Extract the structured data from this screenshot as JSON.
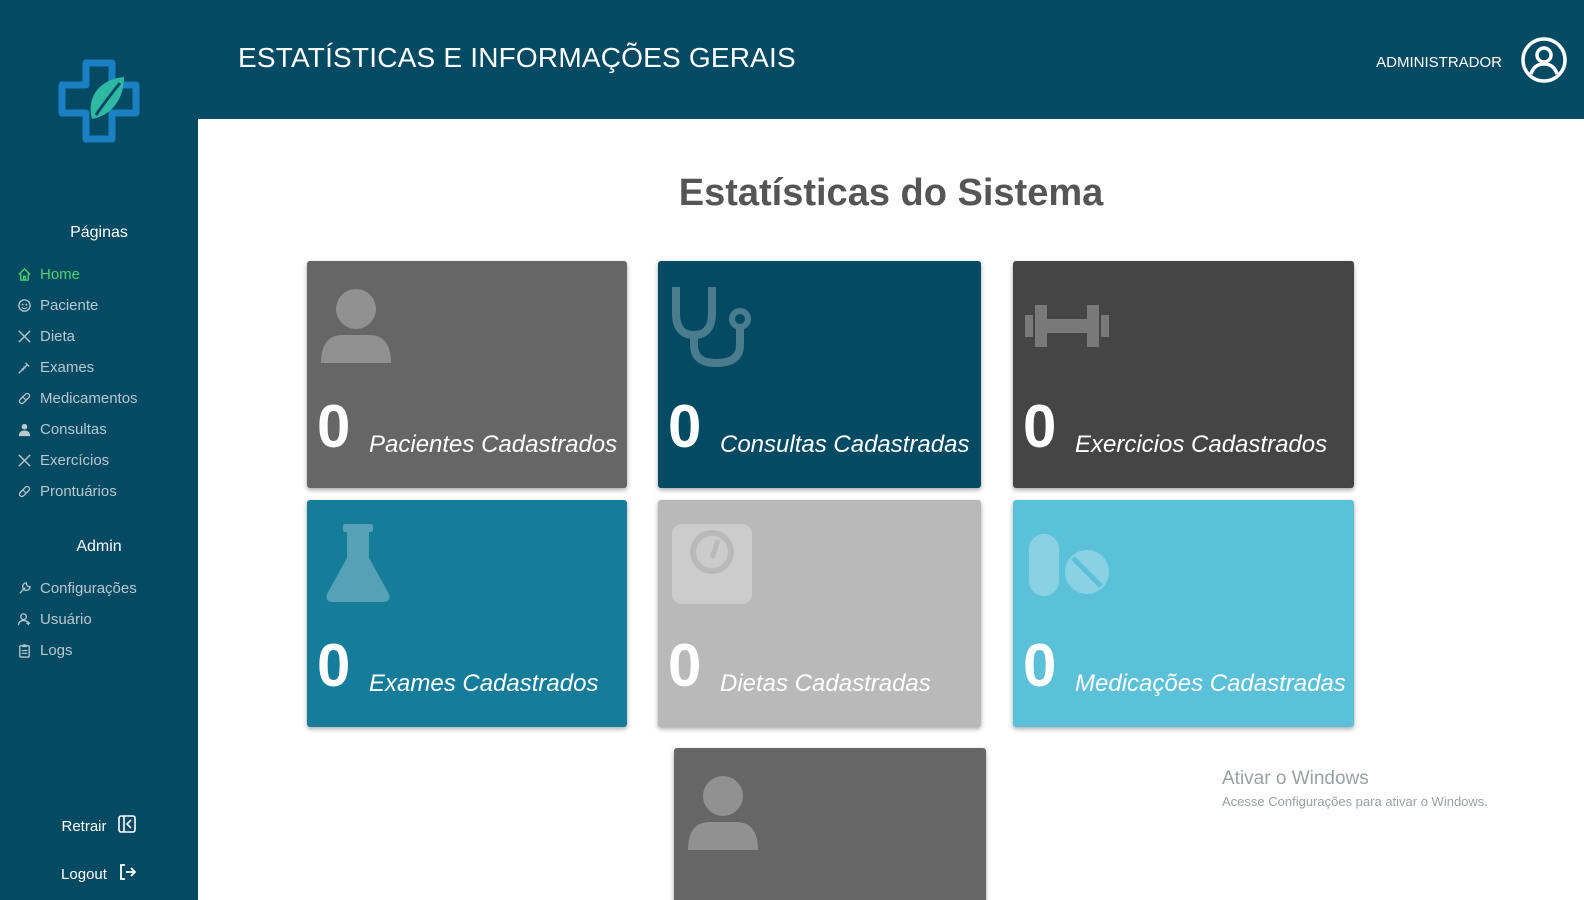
{
  "sidebar": {
    "pages_title": "Páginas",
    "pages": [
      {
        "label": "Home",
        "icon": "home-icon"
      },
      {
        "label": "Paciente",
        "icon": "patient-icon"
      },
      {
        "label": "Dieta",
        "icon": "cutlery-icon"
      },
      {
        "label": "Exames",
        "icon": "syringe-icon"
      },
      {
        "label": "Medicamentos",
        "icon": "pill-icon"
      },
      {
        "label": "Consultas",
        "icon": "doctor-icon"
      },
      {
        "label": "Exercícios",
        "icon": "cutlery-icon"
      },
      {
        "label": "Prontuários",
        "icon": "pill-icon"
      }
    ],
    "admin_title": "Admin",
    "admin": [
      {
        "label": "Configurações",
        "icon": "wrench-icon"
      },
      {
        "label": "Usuário",
        "icon": "user-icon"
      },
      {
        "label": "Logs",
        "icon": "clipboard-icon"
      }
    ],
    "retract_label": "Retrair",
    "logout_label": "Logout"
  },
  "header": {
    "title": "ESTATÍSTICAS E INFORMAÇÕES GERAIS",
    "user_label": "ADMINISTRADOR"
  },
  "main": {
    "heading": "Estatísticas do Sistema",
    "cards": [
      {
        "count": "0",
        "label": "Pacientes Cadastrados",
        "icon": "user-icon",
        "color": "#666666"
      },
      {
        "count": "0",
        "label": "Consultas Cadastradas",
        "icon": "stethoscope-icon",
        "color": "#044a63"
      },
      {
        "count": "0",
        "label": "Exercicios Cadastrados",
        "icon": "dumbbell-icon",
        "color": "#454545"
      },
      {
        "count": "0",
        "label": "Exames Cadastrados",
        "icon": "flask-icon",
        "color": "#157d99"
      },
      {
        "count": "0",
        "label": "Dietas Cadastradas",
        "icon": "scale-icon",
        "color": "#b9b9b9"
      },
      {
        "count": "0",
        "label": "Medicações Cadastradas",
        "icon": "pills-icon",
        "color": "#5bc1d9"
      },
      {
        "count": "",
        "label": "",
        "icon": "user-icon",
        "color": "#666666"
      }
    ]
  },
  "watermark": {
    "title": "Ativar o Windows",
    "subtitle": "Acesse Configurações para ativar o Windows."
  },
  "colors": {
    "sidebar_bg": "#044a63",
    "active_nav": "#4cd36d"
  }
}
